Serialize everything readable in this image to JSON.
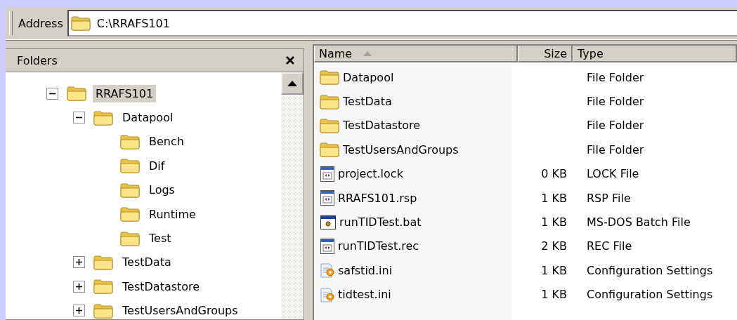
{
  "address": {
    "label": "Address",
    "value": "C:\\RRAFS101"
  },
  "folders_pane": {
    "title": "Folders"
  },
  "tree": [
    {
      "label": "RRAFS101",
      "expanded": true,
      "selected": true,
      "children": [
        {
          "label": "Datapool",
          "expanded": true,
          "selected": false,
          "children": [
            {
              "label": "Bench",
              "selected": false
            },
            {
              "label": "Dif",
              "selected": false
            },
            {
              "label": "Logs",
              "selected": false
            },
            {
              "label": "Runtime",
              "selected": false
            },
            {
              "label": "Test",
              "selected": false
            }
          ]
        },
        {
          "label": "TestData",
          "expanded": false,
          "selected": false
        },
        {
          "label": "TestDatastore",
          "expanded": false,
          "selected": false
        },
        {
          "label": "TestUsersAndGroups",
          "expanded": false,
          "selected": false
        }
      ]
    }
  ],
  "file_list": {
    "columns": [
      {
        "label": "Name",
        "sorted": true
      },
      {
        "label": "Size",
        "sorted": false
      },
      {
        "label": "Type",
        "sorted": false
      }
    ],
    "rows": [
      {
        "kind": "folder",
        "name": "Datapool",
        "size": "",
        "type": "File Folder"
      },
      {
        "kind": "folder",
        "name": "TestData",
        "size": "",
        "type": "File Folder"
      },
      {
        "kind": "folder",
        "name": "TestDatastore",
        "size": "",
        "type": "File Folder"
      },
      {
        "kind": "folder",
        "name": "TestUsersAndGroups",
        "size": "",
        "type": "File Folder"
      },
      {
        "kind": "app",
        "name": "project.lock",
        "size": "0 KB",
        "type": "LOCK File"
      },
      {
        "kind": "app",
        "name": "RRAFS101.rsp",
        "size": "1 KB",
        "type": "RSP File"
      },
      {
        "kind": "batch",
        "name": "runTIDTest.bat",
        "size": "1 KB",
        "type": "MS-DOS Batch File"
      },
      {
        "kind": "app",
        "name": "runTIDTest.rec",
        "size": "2 KB",
        "type": "REC File"
      },
      {
        "kind": "settings",
        "name": "safstid.ini",
        "size": "1 KB",
        "type": "Configuration Settings"
      },
      {
        "kind": "settings",
        "name": "tidtest.ini",
        "size": "1 KB",
        "type": "Configuration Settings"
      }
    ]
  }
}
